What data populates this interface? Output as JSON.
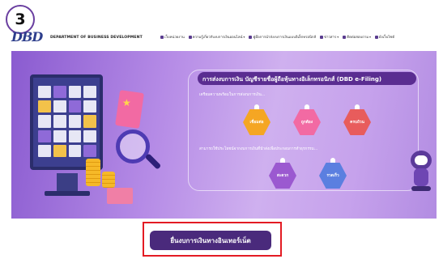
{
  "step": {
    "number": "3"
  },
  "header": {
    "logo_text": "DBD",
    "department": "DEPARTMENT OF BUSINESS DEVELOPMENT",
    "nav": [
      {
        "label": "เว็บหน่วยงาน",
        "icon": "globe-icon"
      },
      {
        "label": "ความรู้เกี่ยวกับงบการเงินออนไลน์",
        "icon": "book-icon",
        "dropdown": true
      },
      {
        "label": "คู่มือการนำส่งงบการเงินแบบอิเล็กทรอนิกส์",
        "icon": "manual-icon"
      },
      {
        "label": "ข่าวสาร",
        "icon": "news-icon",
        "dropdown": true
      },
      {
        "label": "ติดต่อสอบถาม",
        "icon": "contact-icon",
        "dropdown": true
      },
      {
        "label": "ผังเว็บไซต์",
        "icon": "sitemap-icon"
      }
    ]
  },
  "banner": {
    "title": "การส่งงบการเงิน บัญชีรายชื่อผู้ถือหุ้นทางอิเล็กทรอนิกส์ (DBD e-Filing)",
    "ready_text": "เตรียมความพร้อมในการส่งงบการเงิน...",
    "steps": [
      "เชื่อมต่อ",
      "ถูกต้อง",
      "ครบถ้วน"
    ],
    "benefit_text": "สามารถใช้ประโยชน์จากงบการเงินที่นำส่งเพื่อประกอบการทำธุรกรรม...",
    "benefits": [
      "สะดวก",
      "รวดเร็ว"
    ],
    "colors": {
      "step1": "#f5a623",
      "step2": "#f26aa3",
      "step3": "#e85c5c",
      "benefit1": "#9b59d0",
      "benefit2": "#5b7fe0"
    }
  },
  "cta": {
    "label": "ยื่นงบการเงินทางอินเทอร์เน็ต"
  },
  "accent": {
    "highlight_border": "#e31b23",
    "button_bg": "#4a2a7c"
  }
}
